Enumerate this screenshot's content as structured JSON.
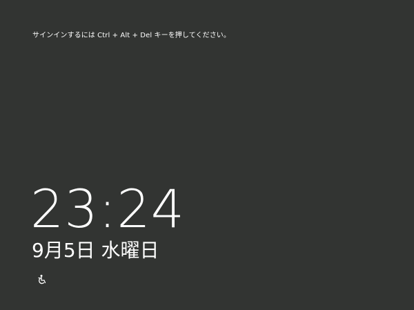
{
  "lock_screen": {
    "sign_in_hint": "サインインするには Ctrl + Alt + Del キーを押してください。",
    "time": "23:24",
    "date": "9月5日 水曜日",
    "ease_of_access_icon": "ease-of-access-icon"
  },
  "colors": {
    "background": "#323432",
    "text": "#ffffff"
  }
}
